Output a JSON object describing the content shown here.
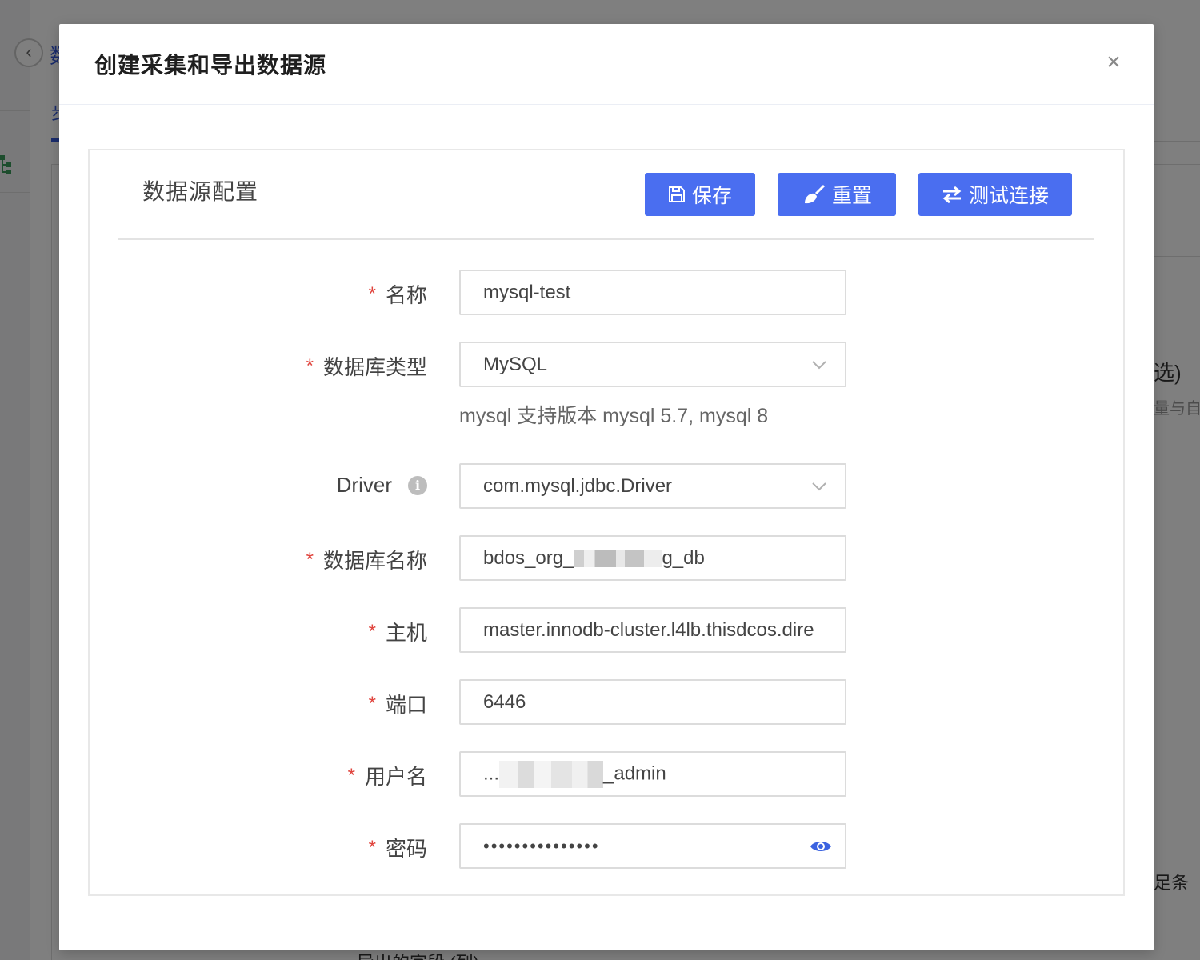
{
  "background": {
    "title_fragment": "数",
    "tab_fragment": "步",
    "right_text_1": "选)",
    "right_text_2": "量与自",
    "right_text_3": "足条",
    "bottom_text": "导出的字段 (列)"
  },
  "modal": {
    "title": "创建采集和导出数据源",
    "close_icon": "×"
  },
  "section": {
    "title": "数据源配置",
    "buttons": {
      "save": "保存",
      "reset": "重置",
      "test": "测试连接"
    }
  },
  "form": {
    "required_mark": "*",
    "name": {
      "label": "名称",
      "value": "mysql-test"
    },
    "db_type": {
      "label": "数据库类型",
      "value": "MySQL",
      "hint": "mysql 支持版本 mysql 5.7, mysql 8"
    },
    "driver": {
      "label": "Driver",
      "value": "com.mysql.jdbc.Driver"
    },
    "db_name": {
      "label": "数据库名称",
      "value_prefix": "bdos_org_",
      "value_suffix": "g_db"
    },
    "host": {
      "label": "主机",
      "value": "master.innodb-cluster.l4lb.thisdcos.dire"
    },
    "port": {
      "label": "端口",
      "value": "6446"
    },
    "username": {
      "label": "用户名",
      "value_prefix": "...",
      "value_suffix": "_admin"
    },
    "password": {
      "label": "密码",
      "value": "•••••••••••••••"
    }
  },
  "colors": {
    "primary": "#4a6ef0",
    "required": "#e0443d",
    "eye": "#3b63e0"
  }
}
